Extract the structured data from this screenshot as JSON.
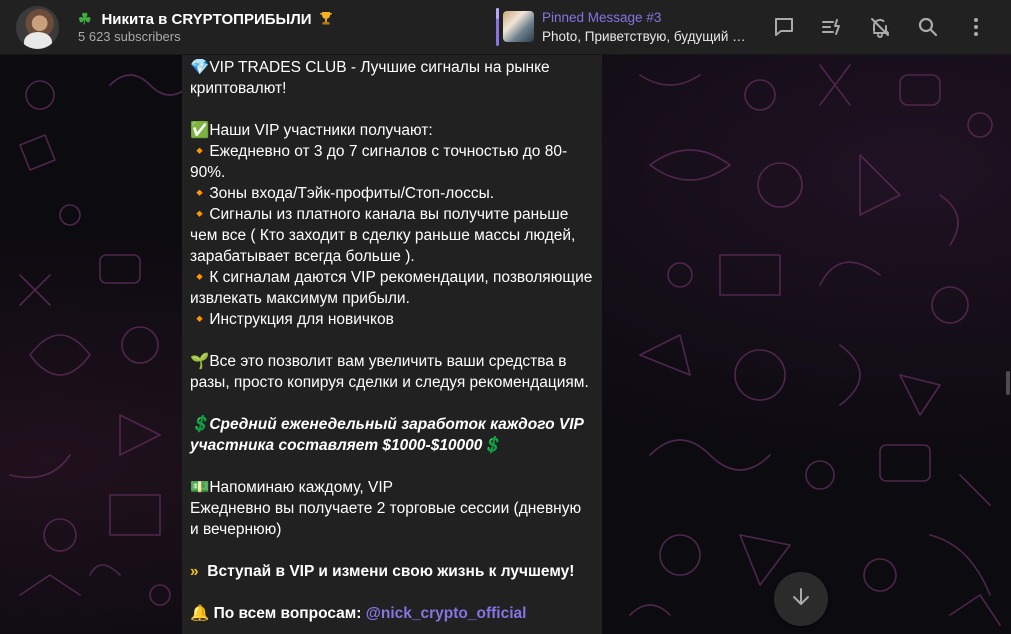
{
  "header": {
    "channel_icon": "four-leaf-clover",
    "title": "Никита в CRYPTOПРИБЫЛИ",
    "title_suffix_icon": "trophy",
    "subscribers": "5 623 subscribers"
  },
  "pinned": {
    "title": "Pinned Message #3",
    "text": "Photo, Приветствую, будущий участник VIP TRADES CLUB"
  },
  "toolbar": {
    "icons": [
      "comments-icon",
      "boost-icon",
      "mute-bell-icon",
      "search-icon",
      "more-vertical-icon"
    ]
  },
  "message": {
    "intro": "VIP TRADES CLUB - Лучшие сигналы на рынке криптовалют!",
    "members_heading": "Наши VIP участники получают:",
    "bullets": [
      "Ежедневно от 3 до 7 сигналов с точностью до 80-90%.",
      "Зоны входа/Тэйк-профиты/Стоп-лоссы.",
      "Сигналы из платного канала вы получите раньше чем все ( Кто заходит в сделку раньше массы людей, зарабатывает всегда больше ).",
      "К сигналам даются VIP рекомендации, позволяющие извлекать максимум прибыли.",
      "Инструкция для новичков"
    ],
    "growth": "Все это позволит вам увеличить ваши средства в разы, просто копируя сделки и следуя рекомендациям.",
    "earnings": "Средний еженедельный заработок каждого VIP участника составляет $1000-$10000",
    "reminder_title": "Напоминаю каждому, VIP",
    "reminder_text": "Ежедневно вы получаете 2 торговые сессии (дневную и вечернюю)",
    "cta": "Вступай в VIP и измени свою жизнь к лучшему!",
    "contact_prefix": "По всем вопросам:",
    "contact_handle": "@nick_crypto_official"
  },
  "colors": {
    "accent": "#8774e1",
    "header_bg": "#212121",
    "bubble_bg": "#212121",
    "pattern": "#5a2b57"
  }
}
